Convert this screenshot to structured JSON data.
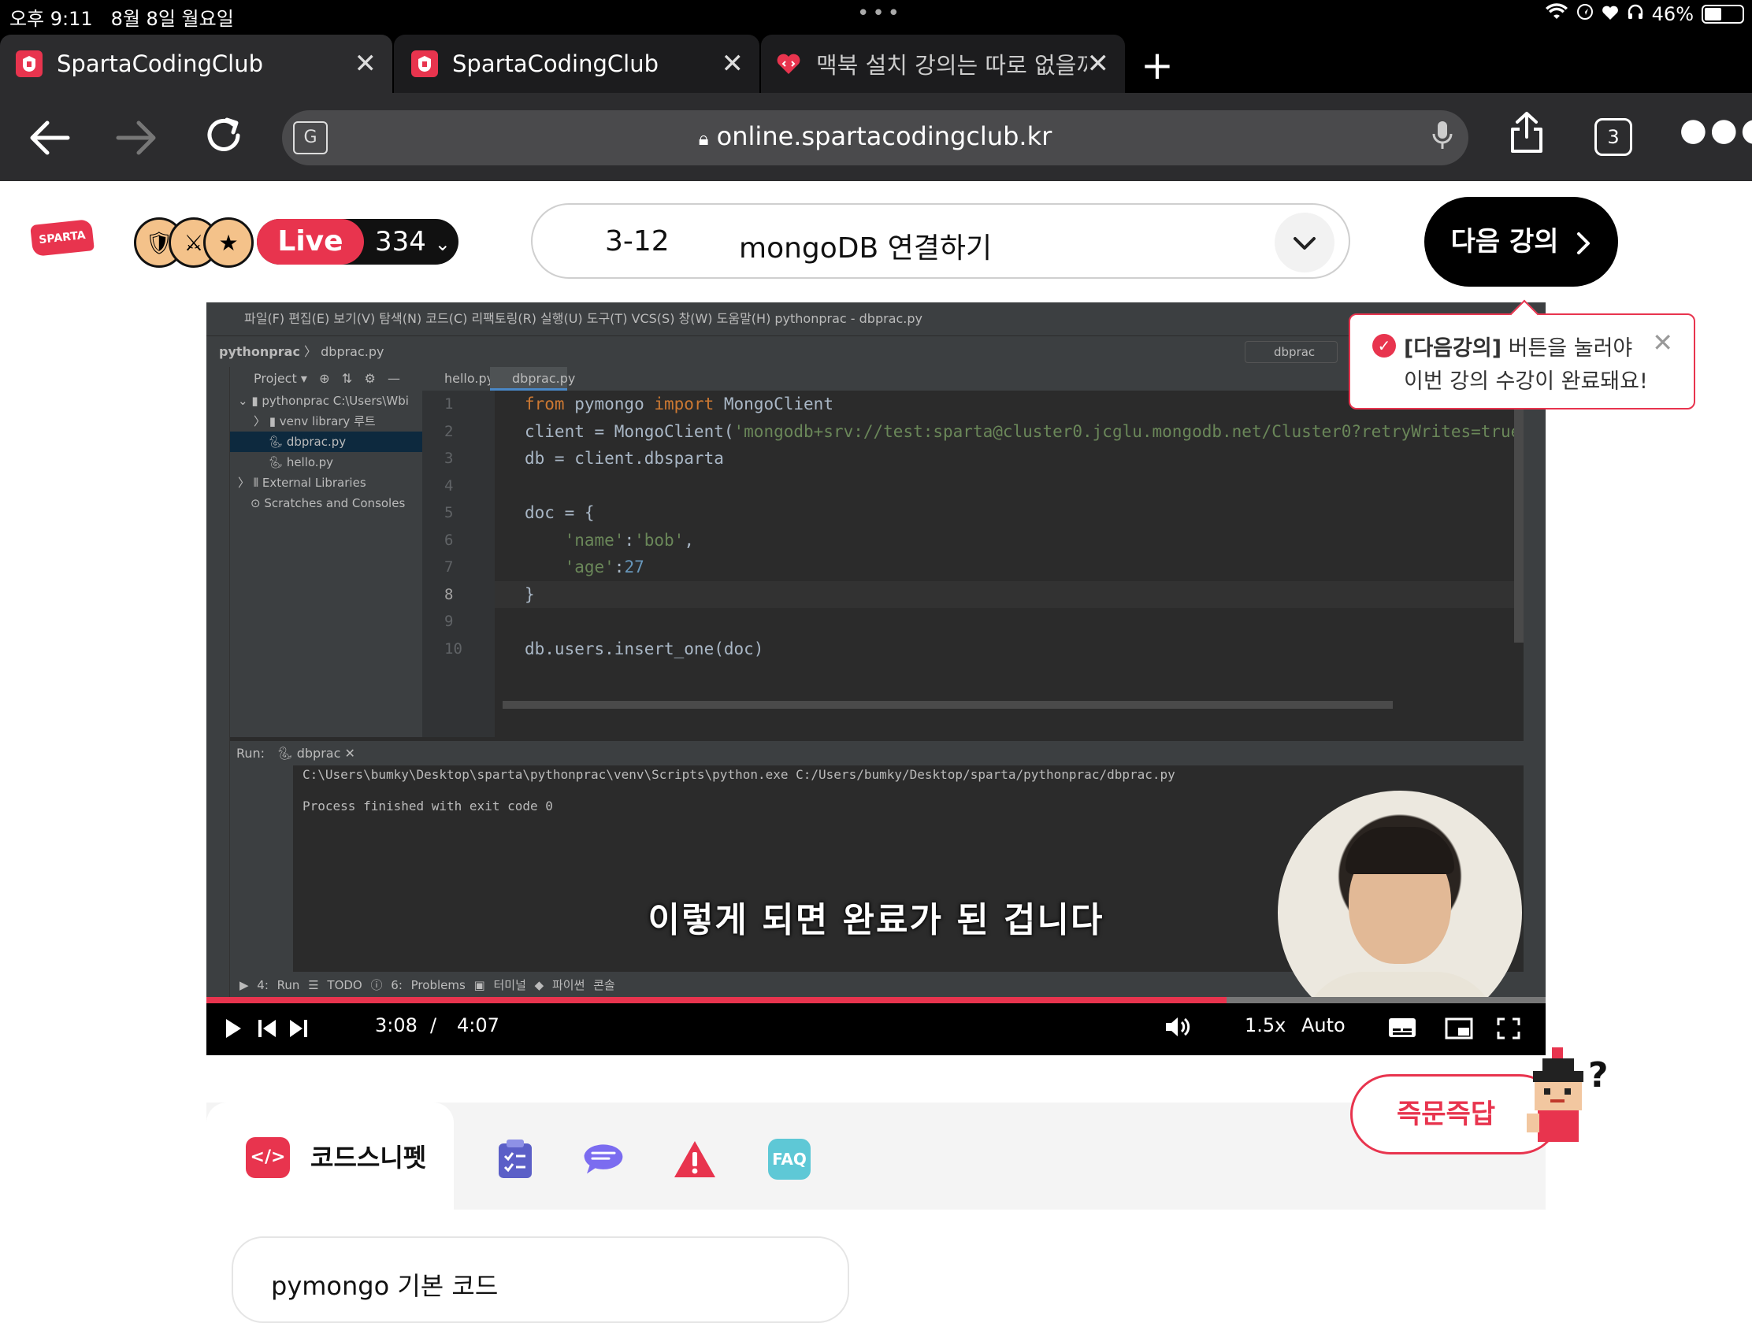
{
  "status_bar": {
    "time": "오후 9:11",
    "date": "8월 8일 월요일",
    "battery": "46%",
    "battery_level": 0.46
  },
  "browser": {
    "tabs": [
      {
        "title": "SpartaCodingClub",
        "active": true
      },
      {
        "title": "SpartaCodingClub",
        "active": false
      },
      {
        "title": "맥북 설치 강의는 따로 없을까요",
        "active": false
      }
    ],
    "url": "online.spartacodingclub.kr",
    "tab_count": "3",
    "icons": {
      "back": "arrow-left-icon",
      "forward": "arrow-right-icon",
      "reload": "reload-icon",
      "translate": "translate-icon",
      "lock": "lock-icon",
      "mic": "microphone-icon",
      "share": "share-icon",
      "more": "more-icon"
    }
  },
  "header": {
    "logo": "SPARTA",
    "live_label": "Live",
    "live_count": "334",
    "lecture_number": "3-12",
    "lecture_title": "mongoDB 연결하기",
    "next_button": "다음 강의"
  },
  "tooltip": {
    "bold": "[다음강의]",
    "line1_rest": " 버튼을 눌러야",
    "line2": "이번 강의 수강이 완료돼요!"
  },
  "video": {
    "ide": {
      "menu": "파일(F)   편집(E)   보기(V)   탐색(N)   코드(C)   리팩토링(R)   실행(U)   도구(T)   VCS(S)   창(W)   도움말(H)      pythonprac - dbprac.py",
      "breadcrumb_project": "pythonprac",
      "breadcrumb_file": "dbprac.py",
      "run_config": "dbprac",
      "project_header": "Project",
      "tree": [
        "pythonprac  C:\\Users\\Wbi",
        "venv  library 루트",
        "dbprac.py",
        "hello.py",
        "External Libraries",
        "Scratches and Consoles"
      ],
      "editor_tabs": [
        "hello.py",
        "dbprac.py"
      ],
      "line_numbers": [
        "1",
        "2",
        "3",
        "4",
        "5",
        "6",
        "7",
        "8",
        "9",
        "10"
      ],
      "code_lines": [
        [
          {
            "t": "from ",
            "c": "kw"
          },
          {
            "t": "pymongo ",
            "c": ""
          },
          {
            "t": "import ",
            "c": "kw"
          },
          {
            "t": "MongoClient",
            "c": ""
          }
        ],
        [
          {
            "t": "client = MongoClient(",
            "c": ""
          },
          {
            "t": "'mongodb+srv://test:sparta@cluster0.jcglu.mongodb.net/Cluster0?retryWrites=true&w=majority'",
            "c": "str"
          },
          {
            "t": ")",
            "c": ""
          }
        ],
        [
          {
            "t": "db = client.dbsparta",
            "c": ""
          }
        ],
        [
          {
            "t": "",
            "c": ""
          }
        ],
        [
          {
            "t": "doc = {",
            "c": ""
          }
        ],
        [
          {
            "t": "    ",
            "c": ""
          },
          {
            "t": "'name'",
            "c": "str"
          },
          {
            "t": ":",
            "c": ""
          },
          {
            "t": "'bob'",
            "c": "str"
          },
          {
            "t": ",",
            "c": ""
          }
        ],
        [
          {
            "t": "    ",
            "c": ""
          },
          {
            "t": "'age'",
            "c": "str"
          },
          {
            "t": ":",
            "c": ""
          },
          {
            "t": "27",
            "c": "num"
          }
        ],
        [
          {
            "t": "}",
            "c": ""
          }
        ],
        [
          {
            "t": "",
            "c": ""
          }
        ],
        [
          {
            "t": "db.users.insert_one(doc)",
            "c": ""
          }
        ]
      ],
      "current_line": 8,
      "run_label": "Run:",
      "run_tab": "dbprac",
      "console_cmd": "C:\\Users\\bumky\\Desktop\\sparta\\pythonprac\\venv\\Scripts\\python.exe C:/Users/bumky/Desktop/sparta/pythonprac/dbprac.py",
      "console_result": "Process finished with exit code 0",
      "status_items": "▶ 4: Run    ☰ TODO    ⓘ 6: Problems    ▣ 터미널    ◆ 파이썬 콘솔"
    },
    "subtitle": "이렇게 되면 완료가 된 겁니다",
    "current_time": "3:08",
    "separator": "/",
    "duration": "4:07",
    "progress_played": 0.762,
    "progress_buffered": 0.762,
    "speed": "1.5x",
    "quality": "Auto"
  },
  "snippet": {
    "active_tab": "코드스니펫",
    "code_title": "pymongo 기본 코드",
    "faq": "FAQ"
  },
  "qna_button": "즉문즉답",
  "colors": {
    "brand": "#e8344e",
    "note_purple": "#5b5fc7",
    "chat_purple": "#7b6cf0",
    "warning_red": "#e8344e",
    "faq_teal": "#5ec8d6"
  }
}
